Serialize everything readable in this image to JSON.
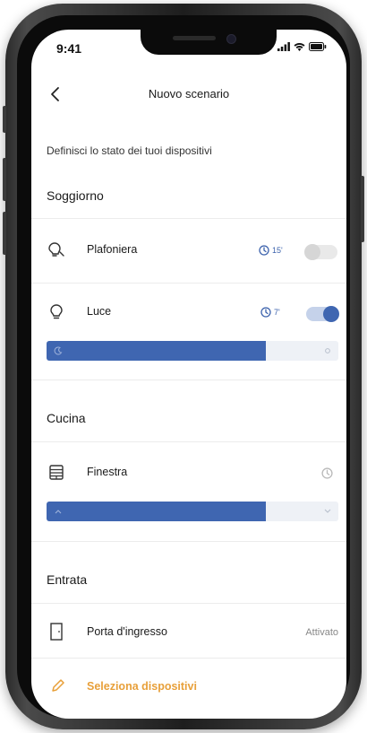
{
  "status": {
    "time": "9:41"
  },
  "header": {
    "title": "Nuovo scenario"
  },
  "subtitle": "Definisci lo stato dei tuoi dispositivi",
  "rooms": [
    {
      "name": "Soggiorno",
      "devices": [
        {
          "name": "Plafoniera",
          "icon": "bulb-icon",
          "timer": "15'",
          "toggle_on": false
        },
        {
          "name": "Luce",
          "icon": "bulb-icon",
          "timer": "7'",
          "toggle_on": true,
          "level": 0.75
        }
      ]
    },
    {
      "name": "Cucina",
      "devices": [
        {
          "name": "Finestra",
          "icon": "blind-icon",
          "level": 0.75
        }
      ]
    },
    {
      "name": "Entrata",
      "devices": [
        {
          "name": "Porta d'ingresso",
          "icon": "door-icon",
          "state": "Attivato"
        }
      ]
    }
  ],
  "actions": {
    "select_devices": "Seleziona dispositivi"
  },
  "colors": {
    "accent": "#3f66b1",
    "action": "#e8a03a"
  }
}
